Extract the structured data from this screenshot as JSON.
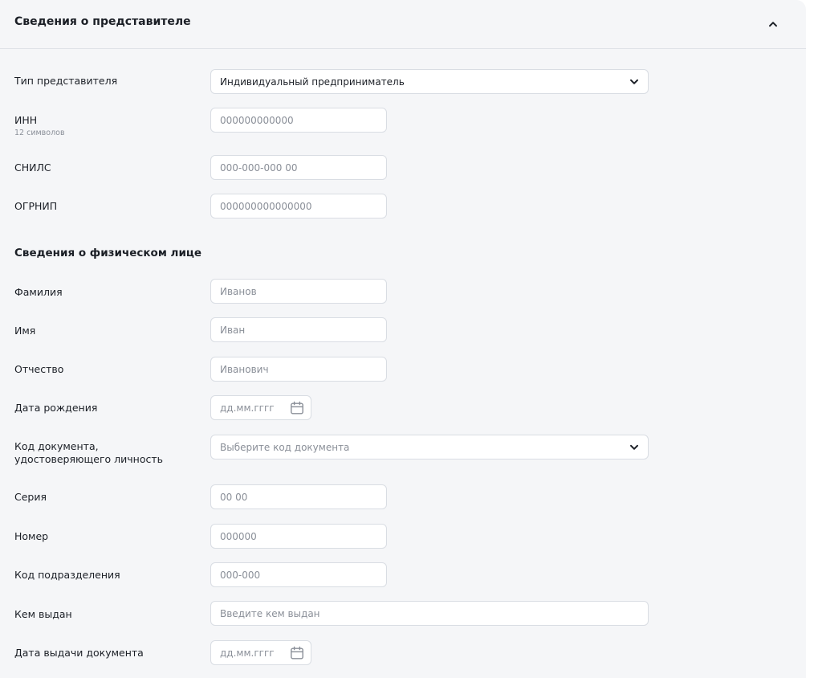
{
  "header": {
    "title": "Сведения о представителе",
    "collapse_icon": "chevron-up-icon"
  },
  "representative": {
    "type": {
      "label": "Тип представителя",
      "value": "Индивидуальный предприниматель"
    },
    "inn": {
      "label": "ИНН",
      "hint": "12 символов",
      "placeholder": "000000000000"
    },
    "snils": {
      "label": "СНИЛС",
      "placeholder": "000-000-000 00"
    },
    "ogrnip": {
      "label": "ОГРНИП",
      "placeholder": "000000000000000"
    }
  },
  "person": {
    "title": "Сведения о физическом лице",
    "surname": {
      "label": "Фамилия",
      "placeholder": "Иванов"
    },
    "name": {
      "label": "Имя",
      "placeholder": "Иван"
    },
    "patronymic": {
      "label": "Отчество",
      "placeholder": "Иванович"
    },
    "birth_date": {
      "label": "Дата рождения",
      "placeholder": "дд.мм.гггг"
    },
    "doc_code": {
      "label_line1": "Код документа,",
      "label_line2": "удостоверяющего личность",
      "placeholder": "Выберите код документа"
    },
    "series": {
      "label": "Серия",
      "placeholder": "00 00"
    },
    "number": {
      "label": "Номер",
      "placeholder": "000000"
    },
    "division_code": {
      "label": "Код подразделения",
      "placeholder": "000-000"
    },
    "issued_by": {
      "label": "Кем выдан",
      "placeholder": "Введите кем выдан"
    },
    "issue_date": {
      "label": "Дата выдачи документа",
      "placeholder": "дд.мм.гггг"
    }
  }
}
